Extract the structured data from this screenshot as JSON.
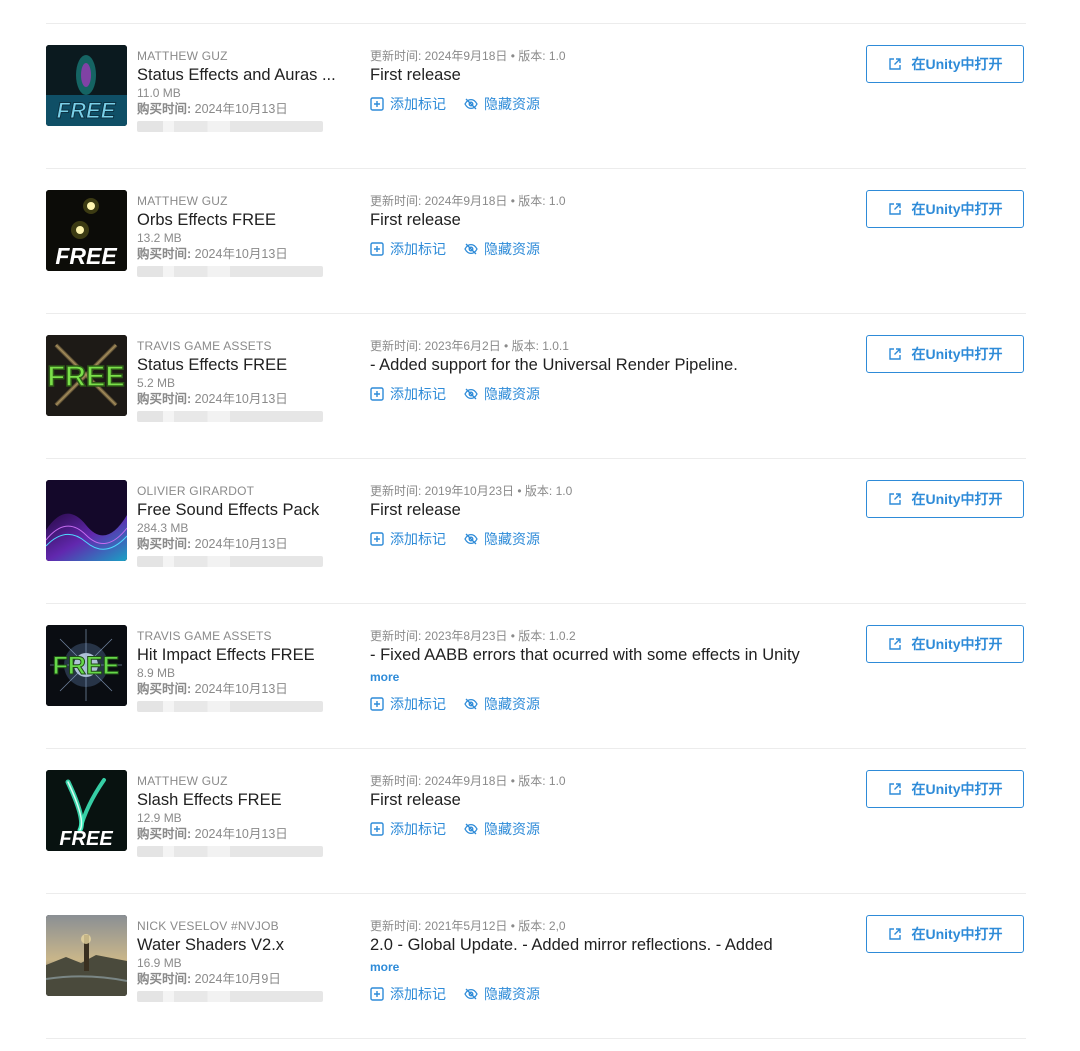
{
  "assets": [
    {
      "publisher": "MATTHEW GUZ",
      "title": "Status Effects and Auras ...",
      "size": "11.0 MB",
      "purchase_label": "购买时间:",
      "purchase_date": "2024年10月13日",
      "updated": "更新时间: 2024年9月18日 • 版本: 1.0",
      "notes": "First release",
      "more": "",
      "thumb_text": "FREE"
    },
    {
      "publisher": "MATTHEW GUZ",
      "title": "Orbs Effects FREE",
      "size": "13.2 MB",
      "purchase_label": "购买时间:",
      "purchase_date": "2024年10月13日",
      "updated": "更新时间: 2024年9月18日 • 版本: 1.0",
      "notes": "First release",
      "more": "",
      "thumb_text": "FREE"
    },
    {
      "publisher": "TRAVIS GAME ASSETS",
      "title": "Status Effects FREE",
      "size": "5.2 MB",
      "purchase_label": "购买时间:",
      "purchase_date": "2024年10月13日",
      "updated": "更新时间: 2023年6月2日 • 版本: 1.0.1",
      "notes": "- Added support for the Universal Render Pipeline.",
      "more": "",
      "thumb_text": "FREE"
    },
    {
      "publisher": "OLIVIER GIRARDOT",
      "title": "Free Sound Effects Pack",
      "size": "284.3 MB",
      "purchase_label": "购买时间:",
      "purchase_date": "2024年10月13日",
      "updated": "更新时间: 2019年10月23日 • 版本: 1.0",
      "notes": "First release",
      "more": "",
      "thumb_text": ""
    },
    {
      "publisher": "TRAVIS GAME ASSETS",
      "title": "Hit Impact Effects FREE",
      "size": "8.9 MB",
      "purchase_label": "购买时间:",
      "purchase_date": "2024年10月13日",
      "updated": "更新时间: 2023年8月23日 • 版本: 1.0.2",
      "notes": "- Fixed AABB errors that ocurred with some effects in Unity",
      "more": "more",
      "thumb_text": "FREE"
    },
    {
      "publisher": "MATTHEW GUZ",
      "title": "Slash Effects FREE",
      "size": "12.9 MB",
      "purchase_label": "购买时间:",
      "purchase_date": "2024年10月13日",
      "updated": "更新时间: 2024年9月18日 • 版本: 1.0",
      "notes": "First release",
      "more": "",
      "thumb_text": "FREE"
    },
    {
      "publisher": "NICK VESELOV #NVJOB",
      "title": "Water Shaders V2.x",
      "size": "16.9 MB",
      "purchase_label": "购买时间:",
      "purchase_date": "2024年10月9日",
      "updated": "更新时间: 2021年5月12日 • 版本: 2,0",
      "notes": "2.0 - Global Update. - Added mirror reflections. - Added",
      "more": "more",
      "thumb_text": ""
    }
  ],
  "labels": {
    "add_tag": "添加标记",
    "hide_asset": "隐藏资源",
    "open_in_unity": "在Unity中打开"
  },
  "colors": {
    "accent": "#2e8bd8",
    "muted": "#8a8a8a",
    "divider": "#ececec"
  },
  "icons": {
    "add_tag": "plus-square-icon",
    "hide_asset": "eye-off-icon",
    "open_in_unity": "external-link-icon"
  }
}
